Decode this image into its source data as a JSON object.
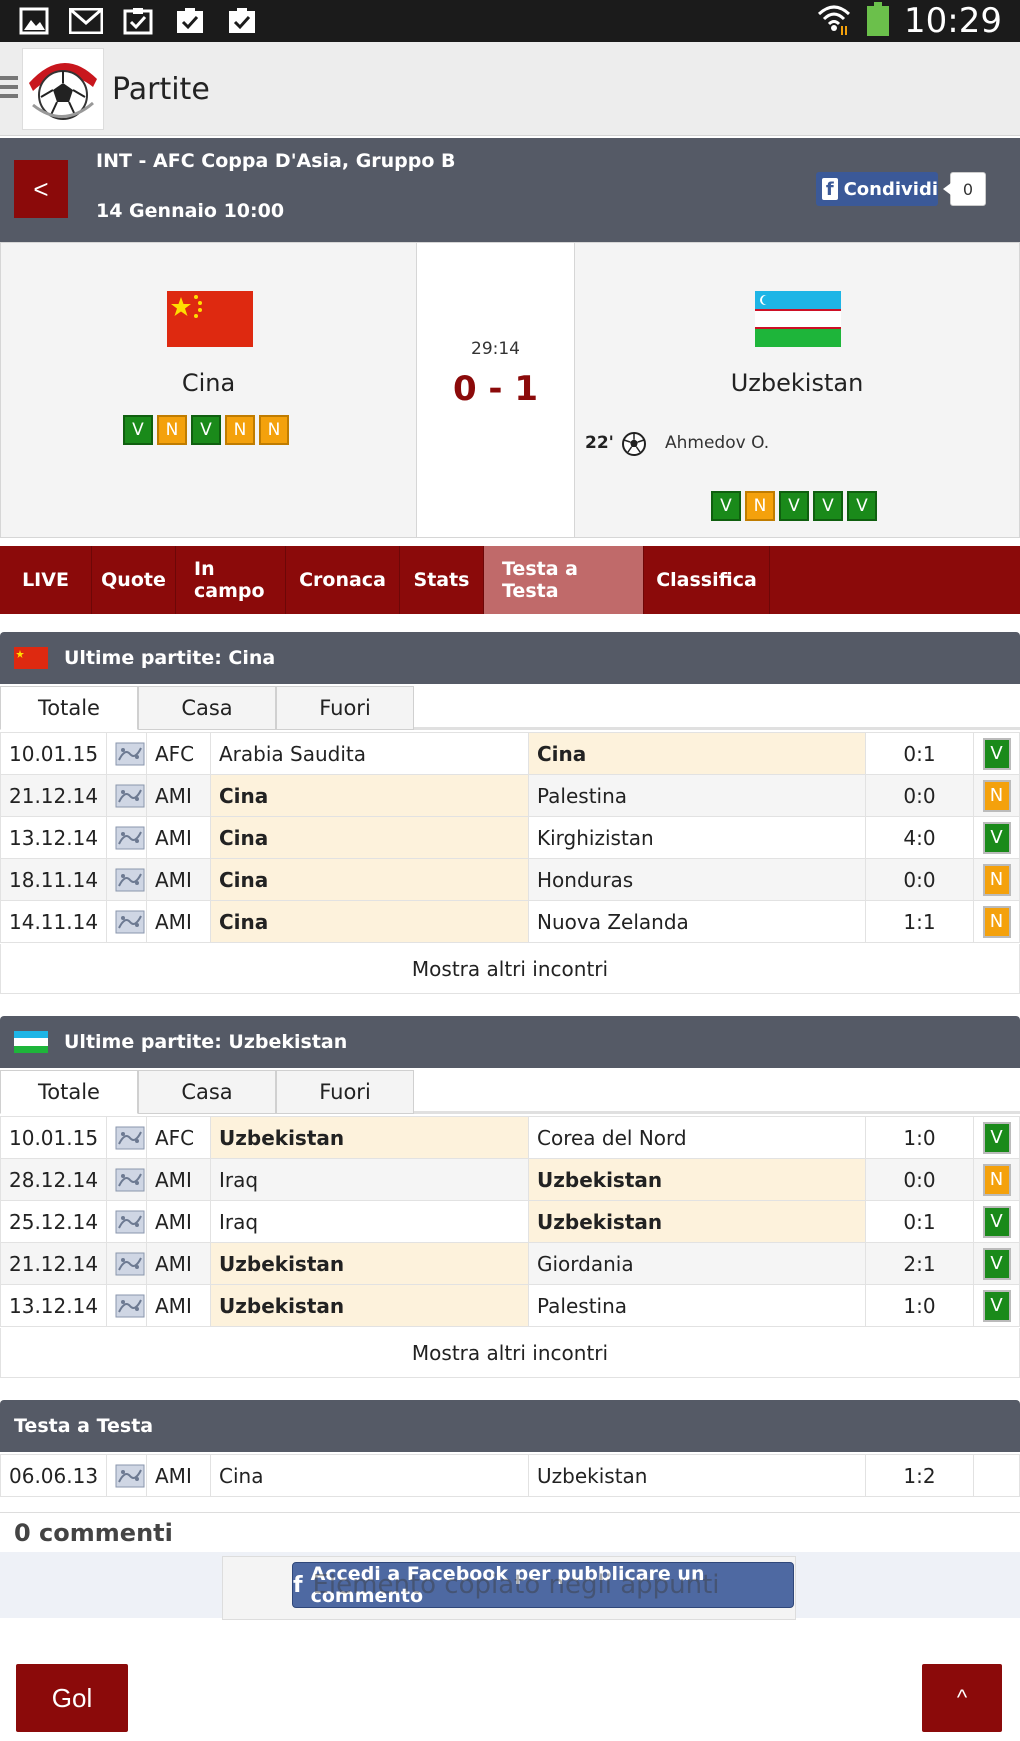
{
  "status_bar": {
    "time": "10:29"
  },
  "app_bar": {
    "title": "Partite"
  },
  "match": {
    "back_label": "<",
    "competition": "INT - AFC Coppa D'Asia, Gruppo B",
    "date": "14 Gennaio 10:00",
    "share_label": "Condividi",
    "share_count": "0",
    "home": {
      "name": "Cina",
      "form": [
        "V",
        "N",
        "V",
        "N",
        "N"
      ]
    },
    "away": {
      "name": "Uzbekistan",
      "form": [
        "V",
        "N",
        "V",
        "V",
        "V"
      ]
    },
    "time": "29:14",
    "score": "0 - 1",
    "goal": {
      "minute": "22'",
      "player": "Ahmedov O."
    }
  },
  "tabs": [
    {
      "label": "LIVE",
      "active": false
    },
    {
      "label": "Quote",
      "active": false
    },
    {
      "label": "In campo",
      "active": false
    },
    {
      "label": "Cronaca",
      "active": false
    },
    {
      "label": "Stats",
      "active": false
    },
    {
      "label": "Testa a Testa",
      "active": true
    },
    {
      "label": "Classifica",
      "active": false
    }
  ],
  "subtabs": [
    "Totale",
    "Casa",
    "Fuori"
  ],
  "home_last": {
    "title": "Ultime partite: Cina",
    "show_more": "Mostra altri incontri",
    "rows": [
      {
        "date": "10.01.15",
        "comp": "AFC",
        "home": "Arabia Saudita",
        "away": "Cina",
        "score": "0:1",
        "result": "V",
        "hl": "away"
      },
      {
        "date": "21.12.14",
        "comp": "AMI",
        "home": "Cina",
        "away": "Palestina",
        "score": "0:0",
        "result": "N",
        "hl": "home"
      },
      {
        "date": "13.12.14",
        "comp": "AMI",
        "home": "Cina",
        "away": "Kirghizistan",
        "score": "4:0",
        "result": "V",
        "hl": "home"
      },
      {
        "date": "18.11.14",
        "comp": "AMI",
        "home": "Cina",
        "away": "Honduras",
        "score": "0:0",
        "result": "N",
        "hl": "home"
      },
      {
        "date": "14.11.14",
        "comp": "AMI",
        "home": "Cina",
        "away": "Nuova Zelanda",
        "score": "1:1",
        "result": "N",
        "hl": "home"
      }
    ]
  },
  "away_last": {
    "title": "Ultime partite: Uzbekistan",
    "show_more": "Mostra altri incontri",
    "rows": [
      {
        "date": "10.01.15",
        "comp": "AFC",
        "home": "Uzbekistan",
        "away": "Corea del Nord",
        "score": "1:0",
        "result": "V",
        "hl": "home"
      },
      {
        "date": "28.12.14",
        "comp": "AMI",
        "home": "Iraq",
        "away": "Uzbekistan",
        "score": "0:0",
        "result": "N",
        "hl": "away"
      },
      {
        "date": "25.12.14",
        "comp": "AMI",
        "home": "Iraq",
        "away": "Uzbekistan",
        "score": "0:1",
        "result": "V",
        "hl": "away"
      },
      {
        "date": "21.12.14",
        "comp": "AMI",
        "home": "Uzbekistan",
        "away": "Giordania",
        "score": "2:1",
        "result": "V",
        "hl": "home"
      },
      {
        "date": "13.12.14",
        "comp": "AMI",
        "home": "Uzbekistan",
        "away": "Palestina",
        "score": "1:0",
        "result": "V",
        "hl": "home"
      }
    ]
  },
  "h2h": {
    "title": "Testa a Testa",
    "rows": [
      {
        "date": "06.06.13",
        "comp": "AMI",
        "home": "Cina",
        "away": "Uzbekistan",
        "score": "1:2",
        "result": ""
      }
    ]
  },
  "comments": {
    "title": "0 commenti",
    "fb_login": "Accedi a Facebook per pubblicare un commento",
    "toast": "Elemento copiato negli appunti"
  },
  "bottom": {
    "gol_label": "Gol",
    "top_label": "^"
  },
  "colors": {
    "accent": "#8b0a0a",
    "header": "#555a66",
    "win": "#1a8a1a",
    "draw": "#f4a10c",
    "facebook": "#3b5998"
  }
}
